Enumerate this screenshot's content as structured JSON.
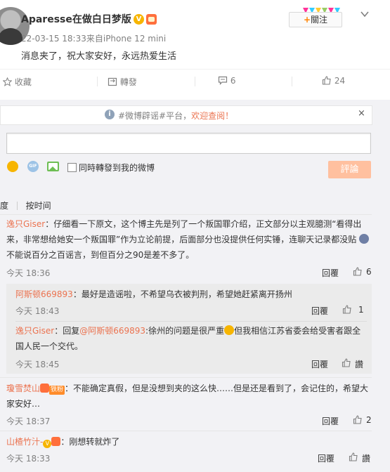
{
  "post": {
    "user_name": "Aparesse在做白日梦版",
    "vip_mark": "V",
    "time_source": "22-03-15 18:33来自iPhone 12 mini",
    "text": "消息夹了，祝大家安好，永远热爱生活",
    "follow_label": "關注",
    "follow_plus": "+"
  },
  "actions": {
    "favorite": "收藏",
    "repost": "轉發",
    "comment_count": "6",
    "like_count": "24"
  },
  "notice": {
    "prefix": "#微博辟谣#平台，",
    "highlight": "欢迎查阅！",
    "close": "×"
  },
  "composer": {
    "gif_label": "GIF",
    "repost_checkbox_label": "同時轉發到我的微博",
    "submit_label": "評論"
  },
  "sort": {
    "left_label": "度",
    "right_label": "按时间"
  },
  "comments": [
    {
      "name": "逸只Giser",
      "line1": "：仔细看一下原文，这个博主先是列了一个叛国罪介绍，正文部分以主观臆测“看得出",
      "line2": "来，非常想给她安一个叛国罪”作为立论前提，后面部分也没提供任何实锤，连聊天记录都没贴",
      "line3": "不能说百分之百谣言，到但百分之90是差不多了。",
      "time": "今天 18:36",
      "reply": "回覆",
      "likes": "6",
      "subs": [
        {
          "name": "阿斯顿669893",
          "text": "：最好是造谣啦，不希望乌衣被判刑，希望她赶紧离开扬州",
          "time": "今天 18:43",
          "reply": "回覆",
          "likes": "1"
        },
        {
          "name": "逸只Giser",
          "text_a": "：回复",
          "mention": "@阿斯顿669893",
          "text_b": ":徐州的问题是很严重",
          "text_c": "但我相信江苏省委会给受害者跟全",
          "line2": "国人民一个交代。",
          "time": "今天 18:45",
          "reply": "回覆",
          "likes": "讚"
        }
      ]
    },
    {
      "name": "瓊雪焚山",
      "badge": "铁粉",
      "line1": "：不能确定真假，但是没想到夹的这么快……但是还是看到了，会记住的，希望大",
      "line2": "家安好…",
      "time": "今天 18:37",
      "reply": "回覆",
      "likes": "2"
    },
    {
      "name": "山楂竹汁-",
      "vip": "V",
      "text": "：刚想转就炸了",
      "time": "今天 18:33",
      "reply": "回覆",
      "likes": "讚"
    }
  ]
}
